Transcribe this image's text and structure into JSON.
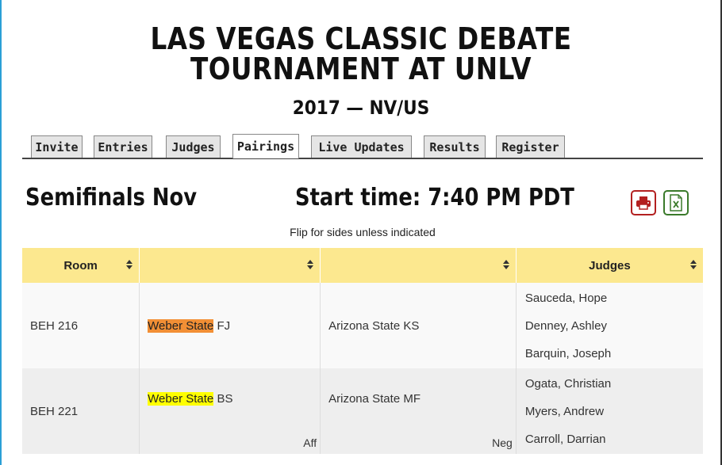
{
  "tournament": {
    "title": "LAS VEGAS CLASSIC DEBATE TOURNAMENT AT UNLV",
    "subtitle": "2017 — NV/US"
  },
  "tabs": [
    "Invite",
    "Entries",
    "Judges",
    "Pairings",
    "Live Updates",
    "Results",
    "Register"
  ],
  "active_tab": "Pairings",
  "round": {
    "name": "Semifinals Nov",
    "start_time": "Start time: 7:40 PM PDT",
    "note": "Flip for sides unless indicated"
  },
  "icons": {
    "print": "printer-icon",
    "excel": "excel-export-icon"
  },
  "colors": {
    "header_bg": "#fce88f",
    "print": "#b32020",
    "excel": "#3a7a2a",
    "highlight_orange": "#f28f35",
    "highlight_yellow": "#ffff00"
  },
  "table": {
    "headers": [
      "Room",
      "",
      "",
      "Judges"
    ],
    "rows": [
      {
        "room": "BEH 216",
        "team1": {
          "school": "Weber State",
          "code": "FJ",
          "side": ""
        },
        "team2": {
          "name": "Arizona State KS",
          "side": ""
        },
        "judges": [
          "Sauceda, Hope",
          "Denney, Ashley",
          "Barquin, Joseph"
        ]
      },
      {
        "room": "BEH 221",
        "team1": {
          "school": "Weber State",
          "code": "BS",
          "side": "Aff"
        },
        "team2": {
          "name": "Arizona State MF",
          "side": "Neg"
        },
        "judges": [
          "Ogata, Christian",
          "Myers, Andrew",
          "Carroll, Darrian"
        ]
      }
    ]
  }
}
